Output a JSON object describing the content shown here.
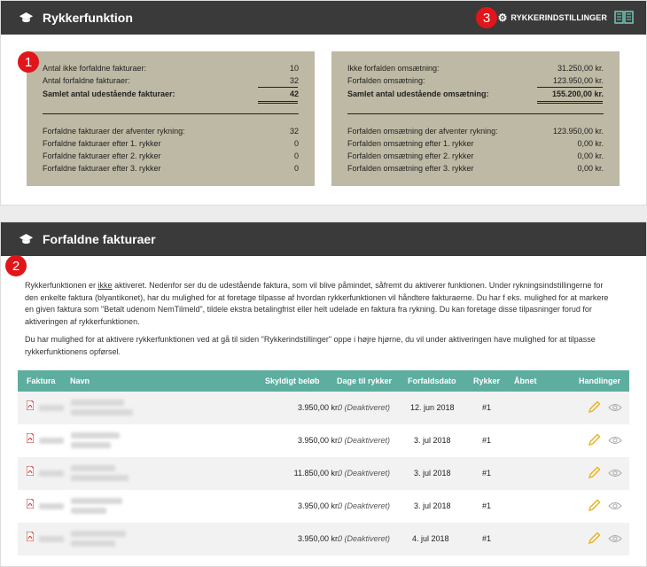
{
  "panel1": {
    "title": "Rykkerfunktion",
    "settings_label": "RYKKERINDSTILLINGER"
  },
  "badges": {
    "b1": "1",
    "b2": "2",
    "b3": "3"
  },
  "left_summary": {
    "rows_top": [
      {
        "label": "Antal ikke forfaldne fakturaer:",
        "value": "10"
      },
      {
        "label": "Antal forfaldne fakturaer:",
        "value": "32"
      }
    ],
    "total": {
      "label": "Samlet antal udestående fakturaer:",
      "value": "42"
    },
    "rows_bottom": [
      {
        "label": "Forfaldne fakturaer der afventer rykning:",
        "value": "32"
      },
      {
        "label": "Forfaldne fakturaer efter 1. rykker",
        "value": "0"
      },
      {
        "label": "Forfaldne fakturaer efter 2. rykker",
        "value": "0"
      },
      {
        "label": "Forfaldne fakturaer efter 3. rykker",
        "value": "0"
      }
    ]
  },
  "right_summary": {
    "rows_top": [
      {
        "label": "Ikke forfalden omsætning:",
        "value": "31.250,00 kr."
      },
      {
        "label": "Forfalden omsætning:",
        "value": "123.950,00 kr."
      }
    ],
    "total": {
      "label": "Samlet antal udestående omsætning:",
      "value": "155.200,00 kr."
    },
    "rows_bottom": [
      {
        "label": "Forfalden omsætning der afventer rykning:",
        "value": "123.950,00 kr."
      },
      {
        "label": "Forfalden omsætning efter 1. rykker",
        "value": "0,00 kr."
      },
      {
        "label": "Forfalden omsætning efter 2. rykker",
        "value": "0,00 kr."
      },
      {
        "label": "Forfalden omsætning efter 3. rykker",
        "value": "0,00 kr."
      }
    ]
  },
  "panel2": {
    "title": "Forfaldne fakturaer",
    "para1_a": "Rykkerfunktionen er ",
    "para1_ikke": "ikke",
    "para1_b": " aktiveret. Nedenfor ser du de udestående faktura, som vil blive påmindet, såfremt du aktiverer funktionen. Under rykningsindstillingerne for den enkelte faktura (blyantikonet), har du mulighed for at foretage tilpasse af hvordan rykkerfunktionen vil håndtere fakturaerne. Du har f eks. mulighed for at markere en given faktura som \"Betalt udenom NemTilmeld\", tildele ekstra betalingfrist eller helt udelade en faktura fra rykning. Du kan foretage disse tilpasninger forud for aktiveringen af rykkerfunktionen.",
    "para2": "Du har mulighed for at aktivere rykkerfunktionen ved at gå til siden \"Rykkerindstillinger\" oppe i højre hjørne, du vil under aktiveringen have mulighed for at tilpasse rykkerfunktionens opførsel."
  },
  "table": {
    "headers": [
      "Faktura",
      "Navn",
      "Skyldigt beløb",
      "Dage til rykker",
      "Forfaldsdato",
      "Rykker",
      "Åbnet",
      "Handlinger"
    ],
    "rows": [
      {
        "amount": "3.950,00 kr.",
        "days": "0 (Deaktiveret)",
        "due": "12. jun 2018",
        "rykker": "#1"
      },
      {
        "amount": "3.950,00 kr.",
        "days": "0 (Deaktiveret)",
        "due": "3. jul 2018",
        "rykker": "#1"
      },
      {
        "amount": "11.850,00 kr.",
        "days": "0 (Deaktiveret)",
        "due": "3. jul 2018",
        "rykker": "#1"
      },
      {
        "amount": "3.950,00 kr.",
        "days": "0 (Deaktiveret)",
        "due": "3. jul 2018",
        "rykker": "#1"
      },
      {
        "amount": "3.950,00 kr.",
        "days": "0 (Deaktiveret)",
        "due": "4. jul 2018",
        "rykker": "#1"
      }
    ]
  },
  "colors": {
    "header_bg": "#3a3a3a",
    "summary_bg": "#beb9a4",
    "table_head": "#5eaea0",
    "badge": "#e0161b",
    "pdf_red": "#c8282a",
    "pencil": "#e8b21e"
  },
  "icons": [
    "graduation-hat-icon",
    "gear-icon",
    "book-icon",
    "pdf-icon",
    "pencil-icon",
    "eye-icon"
  ]
}
